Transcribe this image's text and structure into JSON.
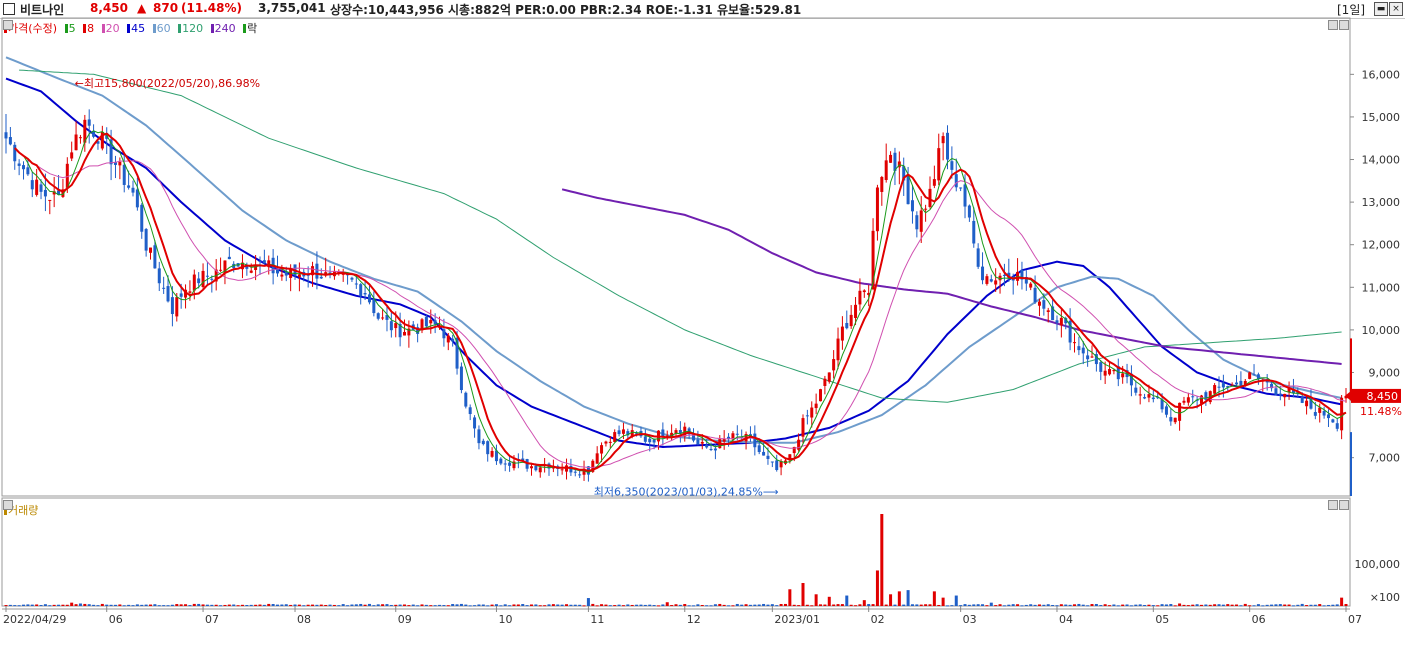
{
  "header": {
    "stock_name": "비트나인",
    "price": "8,450",
    "change_arrow": "▲",
    "change": "870",
    "change_pct": "(11.48%)",
    "volume": "3,755,041",
    "stats": "상장수:10,443,956 시총:882억 PER:0.00 PBR:2.34 ROE:-1.31 유보율:529.81",
    "period": "[1일]",
    "colors": {
      "up": "#e00000",
      "down": "#1f5fc8"
    }
  },
  "legend": [
    {
      "label": "가격(수정)",
      "color": "#e00000"
    },
    {
      "label": "5",
      "color": "#1a9a1a"
    },
    {
      "label": "8",
      "color": "#e00000"
    },
    {
      "label": "20",
      "color": "#d050b0"
    },
    {
      "label": "45",
      "color": "#0000cc"
    },
    {
      "label": "60",
      "color": "#6e9ccc"
    },
    {
      "label": "120",
      "color": "#30a070"
    },
    {
      "label": "240",
      "color": "#7020b0"
    },
    {
      "label": "락",
      "color": "#1a9a1a"
    }
  ],
  "volume_panel": {
    "title": "거래량",
    "color": "#bb8800"
  },
  "icons": {
    "minimize": "minimize-icon",
    "maximize": "maximize-icon",
    "close": "close-icon"
  },
  "chart_data": {
    "type": "candlestick",
    "price_axis": {
      "range": [
        6100,
        16900
      ],
      "ticks": [
        7000,
        9000,
        10000,
        11000,
        12000,
        13000,
        14000,
        15000,
        16000
      ],
      "tick_labels": [
        "7,000",
        "9,000",
        "10,000",
        "11,000",
        "12,000",
        "13,000",
        "14,000",
        "15,000",
        "16,000"
      ]
    },
    "volume_axis": {
      "range": [
        0,
        220000
      ],
      "ticks": [
        100000
      ],
      "tick_labels": [
        "100,000"
      ],
      "unit_label": "×100"
    },
    "x_axis": {
      "labels": [
        "2022/04/29",
        "06",
        "07",
        "08",
        "09",
        "10",
        "11",
        "12",
        "2023/01",
        "02",
        "03",
        "04",
        "05",
        "06",
        "07"
      ],
      "label_index": [
        0,
        23,
        45,
        66,
        89,
        112,
        133,
        155,
        175,
        197,
        218,
        240,
        262,
        284,
        306
      ]
    },
    "annotations": {
      "high": {
        "text": "최고15,800(2022/05/20),86.98%",
        "index": 15,
        "value": 15800
      },
      "low": {
        "text": "최저6,350(2023/01/03),24.85%",
        "index": 176,
        "value": 6350
      }
    },
    "last_price_label": "8,450",
    "last_change_label": "11.48%",
    "price_knots": [
      [
        0,
        14500
      ],
      [
        4,
        13800
      ],
      [
        8,
        13200
      ],
      [
        12,
        13100
      ],
      [
        15,
        14300
      ],
      [
        18,
        14900
      ],
      [
        21,
        14600
      ],
      [
        25,
        13900
      ],
      [
        29,
        13200
      ],
      [
        32,
        12000
      ],
      [
        35,
        11200
      ],
      [
        38,
        10500
      ],
      [
        41,
        11000
      ],
      [
        44,
        11200
      ],
      [
        47,
        11300
      ],
      [
        51,
        11600
      ],
      [
        55,
        11600
      ],
      [
        59,
        11500
      ],
      [
        63,
        11300
      ],
      [
        66,
        11300
      ],
      [
        70,
        11400
      ],
      [
        74,
        11200
      ],
      [
        78,
        11200
      ],
      [
        82,
        10900
      ],
      [
        85,
        10300
      ],
      [
        89,
        10000
      ],
      [
        92,
        10000
      ],
      [
        96,
        10100
      ],
      [
        99,
        10100
      ],
      [
        102,
        9600
      ],
      [
        105,
        8300
      ],
      [
        108,
        7300
      ],
      [
        112,
        7000
      ],
      [
        116,
        6900
      ],
      [
        120,
        6800
      ],
      [
        124,
        6850
      ],
      [
        128,
        6750
      ],
      [
        133,
        6700
      ],
      [
        135,
        7200
      ],
      [
        138,
        7500
      ],
      [
        141,
        7600
      ],
      [
        144,
        7500
      ],
      [
        147,
        7400
      ],
      [
        150,
        7600
      ],
      [
        153,
        7700
      ],
      [
        155,
        7700
      ],
      [
        158,
        7300
      ],
      [
        161,
        7200
      ],
      [
        164,
        7400
      ],
      [
        167,
        7500
      ],
      [
        170,
        7400
      ],
      [
        173,
        7000
      ],
      [
        176,
        6700
      ],
      [
        179,
        7000
      ],
      [
        182,
        7800
      ],
      [
        185,
        8300
      ],
      [
        188,
        9000
      ],
      [
        191,
        10000
      ],
      [
        194,
        10600
      ],
      [
        197,
        11000
      ],
      [
        199,
        13500
      ],
      [
        202,
        14200
      ],
      [
        205,
        13500
      ],
      [
        208,
        12500
      ],
      [
        211,
        13200
      ],
      [
        214,
        14500
      ],
      [
        216,
        13600
      ],
      [
        218,
        13400
      ],
      [
        221,
        12000
      ],
      [
        223,
        11300
      ],
      [
        226,
        11200
      ],
      [
        229,
        11400
      ],
      [
        232,
        11200
      ],
      [
        235,
        10800
      ],
      [
        238,
        10500
      ],
      [
        241,
        10200
      ],
      [
        244,
        9700
      ],
      [
        247,
        9400
      ],
      [
        251,
        9000
      ],
      [
        256,
        8800
      ],
      [
        260,
        8500
      ],
      [
        264,
        8200
      ],
      [
        266,
        7900
      ],
      [
        269,
        8300
      ],
      [
        272,
        8400
      ],
      [
        275,
        8500
      ],
      [
        278,
        8700
      ],
      [
        281,
        8700
      ],
      [
        284,
        8900
      ],
      [
        287,
        8800
      ],
      [
        290,
        8600
      ],
      [
        293,
        8500
      ],
      [
        296,
        8300
      ],
      [
        299,
        8100
      ],
      [
        302,
        8000
      ],
      [
        304,
        7800
      ],
      [
        305,
        8450
      ]
    ],
    "ma": [
      {
        "name": "45",
        "color": "#0000cc",
        "width": 2,
        "points": [
          [
            0,
            15900
          ],
          [
            8,
            15600
          ],
          [
            16,
            14900
          ],
          [
            24,
            14300
          ],
          [
            32,
            13800
          ],
          [
            40,
            13000
          ],
          [
            50,
            12100
          ],
          [
            60,
            11500
          ],
          [
            70,
            11100
          ],
          [
            80,
            10800
          ],
          [
            90,
            10600
          ],
          [
            97,
            10300
          ],
          [
            105,
            9400
          ],
          [
            112,
            8700
          ],
          [
            120,
            8200
          ],
          [
            130,
            7800
          ],
          [
            140,
            7400
          ],
          [
            150,
            7250
          ],
          [
            160,
            7300
          ],
          [
            170,
            7350
          ],
          [
            178,
            7450
          ],
          [
            188,
            7700
          ],
          [
            197,
            8100
          ],
          [
            206,
            8800
          ],
          [
            215,
            9900
          ],
          [
            224,
            10800
          ],
          [
            232,
            11400
          ],
          [
            240,
            11600
          ],
          [
            246,
            11500
          ],
          [
            252,
            11000
          ],
          [
            258,
            10300
          ],
          [
            264,
            9600
          ],
          [
            272,
            9000
          ],
          [
            280,
            8700
          ],
          [
            288,
            8500
          ],
          [
            298,
            8400
          ],
          [
            305,
            8250
          ]
        ]
      },
      {
        "name": "60",
        "color": "#6e9ccc",
        "width": 2,
        "points": [
          [
            0,
            16400
          ],
          [
            12,
            15900
          ],
          [
            22,
            15500
          ],
          [
            32,
            14800
          ],
          [
            42,
            13900
          ],
          [
            54,
            12800
          ],
          [
            64,
            12100
          ],
          [
            74,
            11600
          ],
          [
            84,
            11200
          ],
          [
            94,
            10900
          ],
          [
            104,
            10200
          ],
          [
            112,
            9500
          ],
          [
            122,
            8800
          ],
          [
            132,
            8200
          ],
          [
            142,
            7800
          ],
          [
            152,
            7500
          ],
          [
            162,
            7400
          ],
          [
            172,
            7350
          ],
          [
            180,
            7350
          ],
          [
            190,
            7600
          ],
          [
            200,
            8000
          ],
          [
            210,
            8700
          ],
          [
            220,
            9600
          ],
          [
            230,
            10300
          ],
          [
            240,
            11000
          ],
          [
            248,
            11250
          ],
          [
            254,
            11200
          ],
          [
            262,
            10800
          ],
          [
            270,
            10000
          ],
          [
            278,
            9300
          ],
          [
            288,
            8800
          ],
          [
            298,
            8550
          ],
          [
            305,
            8400
          ]
        ]
      },
      {
        "name": "120",
        "color": "#30a070",
        "width": 1,
        "points": [
          [
            3,
            16100
          ],
          [
            20,
            16000
          ],
          [
            40,
            15500
          ],
          [
            60,
            14500
          ],
          [
            80,
            13800
          ],
          [
            100,
            13200
          ],
          [
            112,
            12600
          ],
          [
            125,
            11700
          ],
          [
            140,
            10800
          ],
          [
            155,
            10000
          ],
          [
            170,
            9400
          ],
          [
            185,
            8900
          ],
          [
            200,
            8400
          ],
          [
            215,
            8300
          ],
          [
            230,
            8600
          ],
          [
            245,
            9200
          ],
          [
            260,
            9600
          ],
          [
            275,
            9700
          ],
          [
            290,
            9800
          ],
          [
            305,
            9950
          ]
        ]
      },
      {
        "name": "240",
        "color": "#7020b0",
        "width": 2,
        "points": [
          [
            127,
            13300
          ],
          [
            135,
            13100
          ],
          [
            145,
            12900
          ],
          [
            155,
            12700
          ],
          [
            165,
            12350
          ],
          [
            175,
            11800
          ],
          [
            185,
            11350
          ],
          [
            195,
            11100
          ],
          [
            205,
            10950
          ],
          [
            215,
            10850
          ],
          [
            225,
            10550
          ],
          [
            235,
            10300
          ],
          [
            245,
            10000
          ],
          [
            255,
            9800
          ],
          [
            265,
            9600
          ],
          [
            275,
            9500
          ],
          [
            285,
            9400
          ],
          [
            295,
            9300
          ],
          [
            305,
            9200
          ]
        ]
      }
    ],
    "volume_spikes": [
      [
        15,
        8000
      ],
      [
        17,
        6000
      ],
      [
        43,
        5000
      ],
      [
        80,
        4000
      ],
      [
        133,
        19000
      ],
      [
        151,
        9000
      ],
      [
        179,
        40000
      ],
      [
        182,
        55000
      ],
      [
        185,
        28000
      ],
      [
        188,
        22000
      ],
      [
        192,
        25000
      ],
      [
        196,
        14000
      ],
      [
        199,
        85000
      ],
      [
        200,
        220000
      ],
      [
        202,
        28000
      ],
      [
        204,
        35000
      ],
      [
        206,
        38000
      ],
      [
        212,
        35000
      ],
      [
        214,
        20000
      ],
      [
        217,
        25000
      ],
      [
        225,
        8000
      ],
      [
        268,
        6000
      ],
      [
        283,
        5000
      ],
      [
        305,
        20000
      ]
    ]
  }
}
